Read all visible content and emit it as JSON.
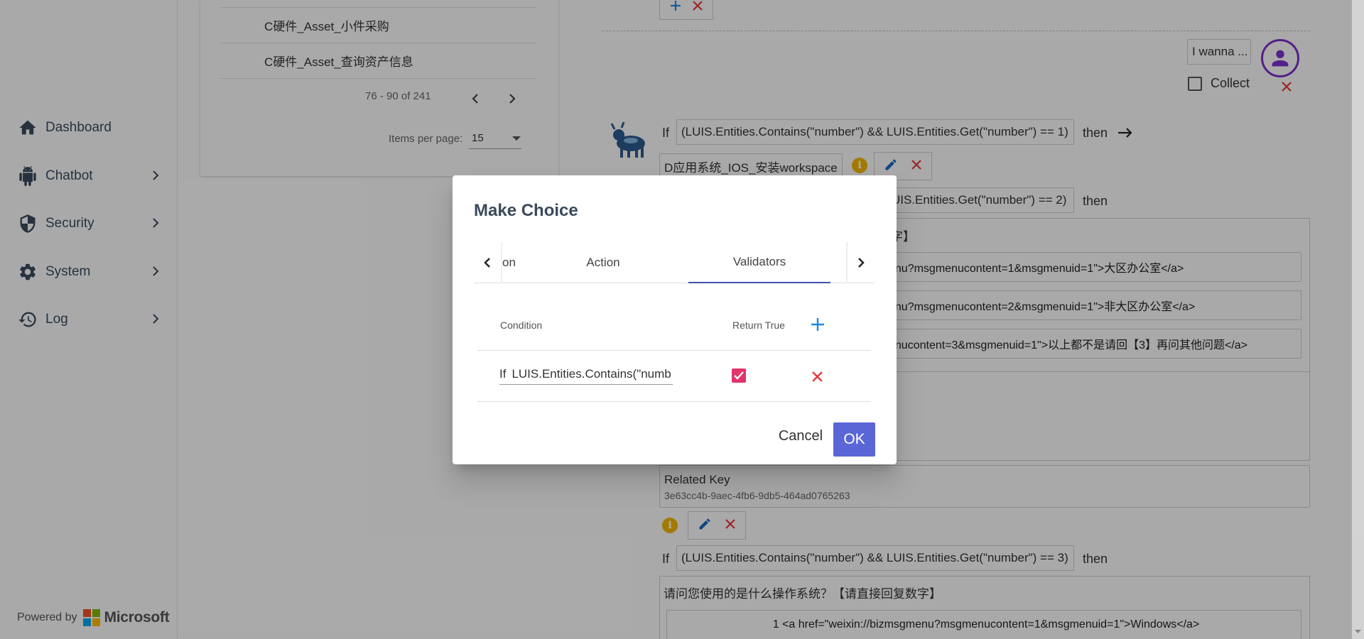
{
  "sidebar": {
    "items": [
      {
        "label": "Dashboard",
        "icon": "home-icon"
      },
      {
        "label": "Chatbot",
        "icon": "android-icon"
      },
      {
        "label": "Security",
        "icon": "shield-icon"
      },
      {
        "label": "System",
        "icon": "gear-icon"
      },
      {
        "label": "Log",
        "icon": "history-icon"
      }
    ],
    "powered_by": "Powered by",
    "brand": "Microsoft"
  },
  "list": {
    "rows": [
      "C硬件_Asset_小件采购",
      "C硬件_Asset_查询资产信息"
    ],
    "range": "76 - 90 of 241",
    "items_per_page_label": "Items per page:",
    "items_per_page": "15"
  },
  "flow": {
    "user_input_placeholder": "I wanna ...",
    "collect_label": "Collect",
    "if_label": "If",
    "then_label": "then",
    "cond1": "(LUIS.Entities.Contains(\"number\") && LUIS.Entities.Get(\"number\") == 1)",
    "action1": "D应用系统_IOS_安装workspace",
    "cond2_fragment": "UIS.Entities.Get(\"number\") == 2)",
    "text2_fragment": "字】",
    "menu_item1": "enu?msgmenucontent=1&msgmenuid=1\">大区办公室</a>",
    "menu_item2": "enu?msgmenucontent=2&msgmenuid=1\">非大区办公室</a>",
    "menu_item3": "enucontent=3&msgmenuid=1\">以上都不是请回【3】再问其他问题</a>",
    "related_key_label": "Related Key",
    "related_key_value": "3e63cc4b-9aec-4fb6-9db5-464ad0765263",
    "cond3": "(LUIS.Entities.Contains(\"number\") && LUIS.Entities.Get(\"number\") == 3)",
    "question3": "请问您使用的是什么操作系统？【请直接回复数字】",
    "option3_1": "1 <a href=\"weixin://bizmsgmenu?msgmenucontent=1&msgmenuid=1\">Windows</a>"
  },
  "dialog": {
    "title": "Make Choice",
    "tabs": [
      "on",
      "Action",
      "Validators"
    ],
    "active_tab": "Validators",
    "col_condition": "Condition",
    "col_return_true": "Return True",
    "row_prefix": "If",
    "row_condition": "LUIS.Entities.Contains(\"numb",
    "return_true": true,
    "cancel_label": "Cancel",
    "ok_label": "OK"
  },
  "colors": {
    "accent": "#3f51b5",
    "ok_button": "#5a66d6",
    "delete": "#e53935",
    "add": "#1e88e5",
    "checkbox": "#e2336b",
    "info": "#f0b400",
    "avatar": "#7b2fc9"
  }
}
